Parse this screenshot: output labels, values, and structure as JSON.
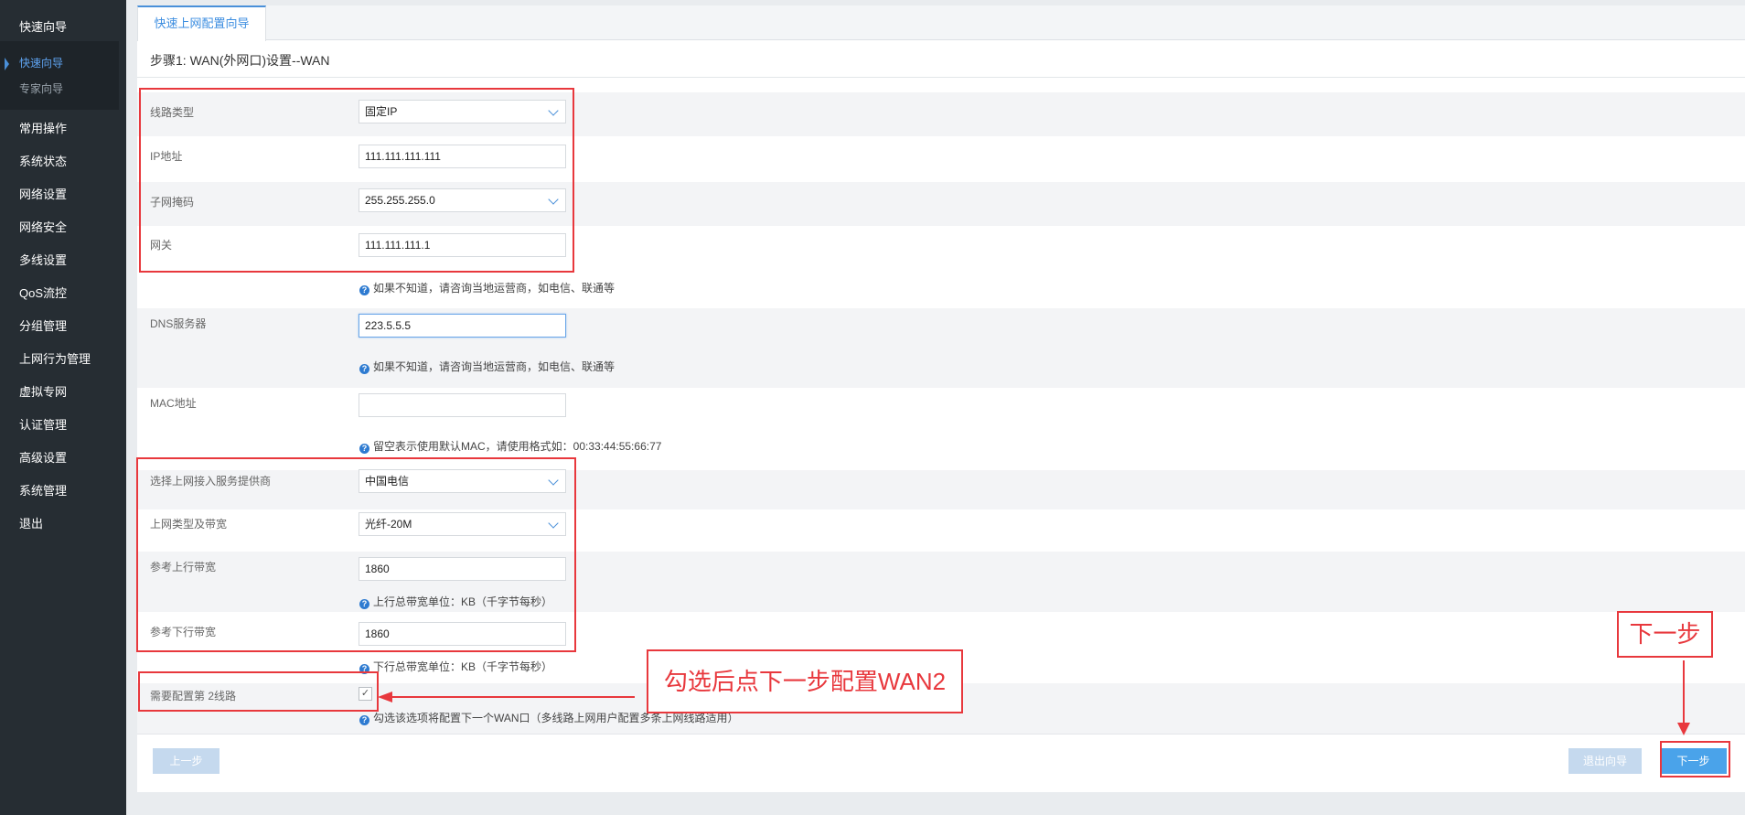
{
  "sidebar": {
    "top_item": "快速向导",
    "sub_items": [
      {
        "label": "快速向导"
      },
      {
        "label": "专家向导"
      }
    ],
    "items": [
      {
        "label": "常用操作"
      },
      {
        "label": "系统状态"
      },
      {
        "label": "网络设置"
      },
      {
        "label": "网络安全"
      },
      {
        "label": "多线设置"
      },
      {
        "label": "QoS流控"
      },
      {
        "label": "分组管理"
      },
      {
        "label": "上网行为管理"
      },
      {
        "label": "虚拟专网"
      },
      {
        "label": "认证管理"
      },
      {
        "label": "高级设置"
      },
      {
        "label": "系统管理"
      },
      {
        "label": "退出"
      }
    ]
  },
  "main": {
    "tab": "快速上网配置向导",
    "step_title": "步骤1: WAN(外网口)设置--WAN"
  },
  "form": {
    "line_type": {
      "label": "线路类型",
      "value": "固定IP"
    },
    "ip": {
      "label": "IP地址",
      "value": "111.111.111.111"
    },
    "mask": {
      "label": "子网掩码",
      "value": "255.255.255.0"
    },
    "gateway": {
      "label": "网关",
      "value": "111.111.111.1"
    },
    "gateway_hint": "如果不知道，请咨询当地运营商，如电信、联通等",
    "dns": {
      "label": "DNS服务器",
      "value": "223.5.5.5"
    },
    "dns_hint": "如果不知道，请咨询当地运营商，如电信、联通等",
    "mac": {
      "label": "MAC地址",
      "value": ""
    },
    "mac_hint": "留空表示使用默认MAC，请使用格式如：00:33:44:55:66:77",
    "isp": {
      "label": "选择上网接入服务提供商",
      "value": "中国电信"
    },
    "bandwidth_type": {
      "label": "上网类型及带宽",
      "value": "光纤-20M"
    },
    "upload": {
      "label": "参考上行带宽",
      "value": "1860",
      "hint": "上行总带宽单位：KB（千字节每秒）"
    },
    "download": {
      "label": "参考下行带宽",
      "value": "1860",
      "hint": "下行总带宽单位：KB（千字节每秒）"
    },
    "second_line": {
      "label": "需要配置第 2线路",
      "checked": "✓",
      "hint": "勾选该选项将配置下一个WAN口（多线路上网用户配置多条上网线路适用）"
    }
  },
  "buttons": {
    "prev": "上一步",
    "exit": "退出向导",
    "next": "下一步"
  },
  "annotations": {
    "callout_check": "勾选后点下一步配置WAN2",
    "callout_next": "下一步"
  },
  "icons": {
    "help": "?"
  }
}
